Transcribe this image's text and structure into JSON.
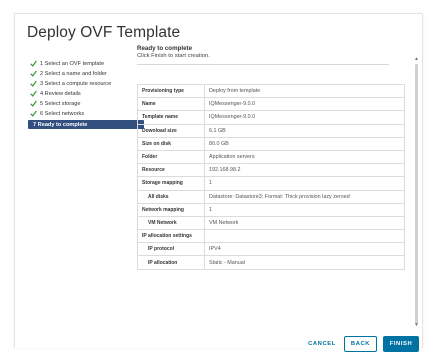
{
  "dialog": {
    "title": "Deploy OVF Template"
  },
  "steps": [
    {
      "label": "1 Select an OVF template",
      "done": true
    },
    {
      "label": "2 Select a name and folder",
      "done": true
    },
    {
      "label": "3 Select a compute resource",
      "done": true
    },
    {
      "label": "4 Review details",
      "done": true
    },
    {
      "label": "5 Select storage",
      "done": true
    },
    {
      "label": "6 Select networks",
      "done": true
    },
    {
      "label": "7 Ready to complete",
      "done": false,
      "active": true
    }
  ],
  "content": {
    "heading": "Ready to complete",
    "subheading": "Click Finish to start creation."
  },
  "summary": [
    {
      "key": "Provisioning type",
      "value": "Deploy from template"
    },
    {
      "key": "Name",
      "value": "IQMessenger-9.0.0"
    },
    {
      "key": "Template name",
      "value": "IQMessenger-9.0.0"
    },
    {
      "key": "Download size",
      "value": "6.1 GB"
    },
    {
      "key": "Size on disk",
      "value": "80.0 GB"
    },
    {
      "key": "Folder",
      "value": "Application servers"
    },
    {
      "key": "Resource",
      "value": "192.168.98.2"
    },
    {
      "key": "Storage mapping",
      "value": "1"
    },
    {
      "key": "All disks",
      "value": "Datastore: Datastore3; Format: Thick provision lazy zeroed",
      "sub": true
    },
    {
      "key": "Network mapping",
      "value": "1"
    },
    {
      "key": "VM Network",
      "value": "VM Network",
      "sub": true
    },
    {
      "key": "IP allocation settings",
      "value": ""
    },
    {
      "key": "IP protocol",
      "value": "IPV4",
      "sub": true
    },
    {
      "key": "IP allocation",
      "value": "Static - Manual",
      "sub": true
    }
  ],
  "footer": {
    "cancel_label": "CANCEL",
    "back_label": "BACK",
    "finish_label": "FINISH"
  },
  "colors": {
    "accent": "#0072a3",
    "check": "#3a9b3a",
    "active_step_bg": "#324f80"
  }
}
